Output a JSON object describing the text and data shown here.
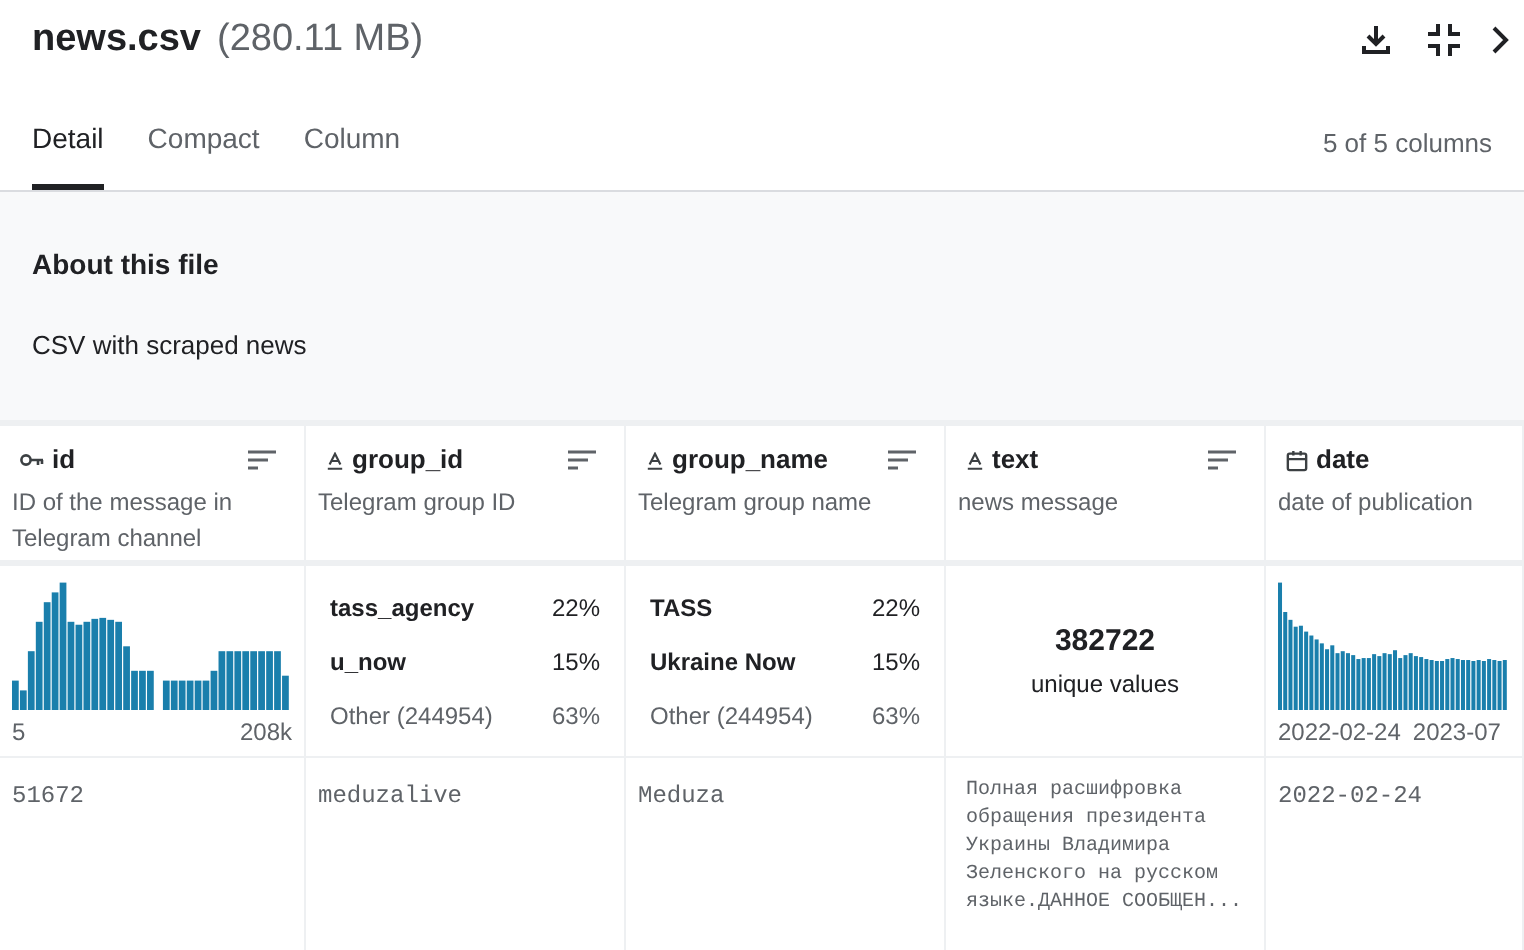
{
  "file": {
    "name": "news.csv",
    "size": "(280.11 MB)"
  },
  "tabs": [
    {
      "label": "Detail",
      "selected": true
    },
    {
      "label": "Compact",
      "selected": false
    },
    {
      "label": "Column",
      "selected": false
    }
  ],
  "column_count": "5 of 5 columns",
  "about": {
    "title": "About this file",
    "description": "CSV with scraped news"
  },
  "columns": [
    {
      "name": "id",
      "kind": "key",
      "description": "ID of the message in Telegram channel",
      "summary": {
        "kind": "histogram",
        "min_label": "5",
        "max_label": "208k"
      },
      "value": "51672"
    },
    {
      "name": "group_id",
      "kind": "string",
      "description": "Telegram group ID",
      "summary": {
        "kind": "top",
        "items": [
          {
            "label": "tass_agency",
            "share": "22%",
            "other": false
          },
          {
            "label": "u_now",
            "share": "15%",
            "other": false
          },
          {
            "label": "Other (244954)",
            "share": "63%",
            "other": true
          }
        ]
      },
      "value": "meduzalive"
    },
    {
      "name": "group_name",
      "kind": "string",
      "description": "Telegram group name",
      "summary": {
        "kind": "top",
        "items": [
          {
            "label": "TASS",
            "share": "22%",
            "other": false
          },
          {
            "label": "Ukraine Now",
            "share": "15%",
            "other": false
          },
          {
            "label": "Other (244954)",
            "share": "63%",
            "other": true
          }
        ]
      },
      "value": "Meduza"
    },
    {
      "name": "text",
      "kind": "string",
      "description": "news message",
      "summary": {
        "kind": "unique",
        "count": "382722",
        "label": "unique values"
      },
      "value": "Полная расшифровка обращения президента Украины Владимира Зеленского на русском языке.ДАННОЕ СООБЩЕН..."
    },
    {
      "name": "date",
      "kind": "date",
      "description": "date of publication",
      "summary": {
        "kind": "histogram",
        "min_label": "2022-02-24",
        "max_label": "2023-07"
      },
      "value": "2022-02-24"
    }
  ]
}
